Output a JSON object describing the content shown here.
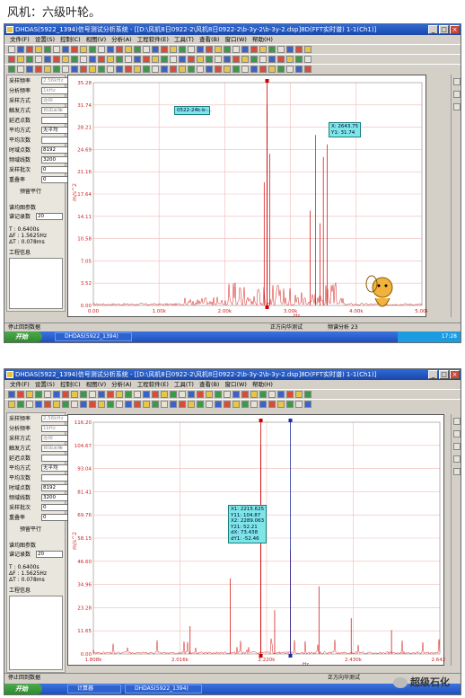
{
  "caption": "风机：六级叶轮。",
  "win1": {
    "title": "DHDAS(5922_1394)信号测试分析系统 - [[D:\\风机8日0922-2\\风机8日0922-2\\b-3y-2\\b-3y-2.dsp]8D(FFT实时谱) 1-1(Ch1)]",
    "menu": [
      "文件(F)",
      "设置(S)",
      "控制(C)",
      "视图(V)",
      "分析(A)",
      "工程软件(E)",
      "工具(T)",
      "查看(B)",
      "窗口(W)",
      "帮助(H)"
    ],
    "params": [
      {
        "label": "采样频率",
        "value": "2.56kHz",
        "active": false
      },
      {
        "label": "分析频率",
        "value": "1kHz",
        "active": false
      },
      {
        "label": "采样方式",
        "value": "连续",
        "active": false
      },
      {
        "label": "触发方式",
        "value": "自由采集",
        "active": false
      },
      {
        "label": "延迟点数",
        "value": "",
        "active": false
      },
      {
        "label": "平均方式",
        "value": "无平均",
        "active": true
      },
      {
        "label": "平均次数",
        "value": "",
        "active": false
      },
      {
        "label": "时域点数",
        "value": "8192",
        "active": true
      },
      {
        "label": "频域线数",
        "value": "3200",
        "active": true
      },
      {
        "label": "采样批次",
        "value": "0",
        "active": true
      },
      {
        "label": "重叠率",
        "value": "0",
        "active": true
      }
    ],
    "checkbox_label": "预留平行",
    "records_label": "谱均图参数",
    "records_count_label": "谱记录数",
    "records_count_value": "20",
    "stats": [
      "T : 0.6400s",
      "ΔF : 1.5625Hz",
      "ΔT : 0.078ms"
    ],
    "info_label": "工程信息",
    "status_text": "停止回到数据",
    "status_right": "正方向华测试",
    "status_freq": "频谱分析 23",
    "cursor_popup": "0522-24k-b-...",
    "cursor_readout": "X: 2643.75\nY1: 31.74",
    "ylabel": "m/s^2",
    "xlabel": "Hz",
    "task_label": "DHDAS(5922_1394)",
    "tray_time": "17:28",
    "start_label": "开始"
  },
  "win2": {
    "title": "DHDAS(5922_1394)信号测试分析系统 - [[D:\\风机8日0922-2\\风机8日0922-2\\b-3y-2\\b-3y-2.dsp]8D(FFT实时谱) 1-1(Ch1)]",
    "menu": [
      "文件(F)",
      "设置(S)",
      "控制(C)",
      "视图(V)",
      "分析(A)",
      "工程软件(E)",
      "工具(T)",
      "查看(B)",
      "窗口(W)",
      "帮助(H)"
    ],
    "params": [
      {
        "label": "采样频率",
        "value": "2.56kHz",
        "active": false
      },
      {
        "label": "分析频率",
        "value": "1kHz",
        "active": false
      },
      {
        "label": "采样方式",
        "value": "连续",
        "active": false
      },
      {
        "label": "触发方式",
        "value": "自由采集",
        "active": false
      },
      {
        "label": "延迟点数",
        "value": "",
        "active": false
      },
      {
        "label": "平均方式",
        "value": "无平均",
        "active": true
      },
      {
        "label": "平均次数",
        "value": "",
        "active": false
      },
      {
        "label": "时域点数",
        "value": "8192",
        "active": true
      },
      {
        "label": "频域线数",
        "value": "3200",
        "active": true
      },
      {
        "label": "采样批次",
        "value": "0",
        "active": true
      },
      {
        "label": "重叠率",
        "value": "0",
        "active": true
      }
    ],
    "checkbox_label": "预留平行",
    "records_label": "谱均图参数",
    "records_count_label": "谱记录数",
    "records_count_value": "20",
    "stats": [
      "T : 0.6400s",
      "ΔF : 1.5625Hz",
      "ΔT : 0.078ms"
    ],
    "info_label": "工程信息",
    "status_text": "停止回到数据",
    "status_right": "正方向华测试",
    "status_freq": "频谱分析 23",
    "cursor_readout": "X1: 2215.625\nY11: 104.87\nX2: 2289.063\nY21: 52.21\ndX: 73.438\ndY1: -52.46",
    "ylabel": "m/s^2",
    "xlabel": "Hz",
    "task_label": "DHDAS(5922_1394)",
    "task_label2": "计算器",
    "start_label": "开始",
    "logo_text": "超级石化"
  },
  "chart_data": [
    {
      "type": "line",
      "title": "",
      "xlabel": "Hz",
      "ylabel": "m/s^2",
      "xlim": [
        0,
        5000
      ],
      "ylim": [
        0,
        35.28
      ],
      "x_ticks": [
        "0.00",
        "1.00k",
        "2.00k",
        "3.00k",
        "4.00k",
        "5.00k"
      ],
      "y_ticks": [
        "0.00",
        "3.52",
        "7.05",
        "10.58",
        "14.11",
        "17.64",
        "21.16",
        "24.69",
        "28.21",
        "31.74",
        "35.28"
      ],
      "grid": true,
      "peaks": [
        {
          "x": 2643.75,
          "y": 31.74
        },
        {
          "x": 2600,
          "y": 19.5
        },
        {
          "x": 2685,
          "y": 24.0
        },
        {
          "x": 3380,
          "y": 27.0
        },
        {
          "x": 3500,
          "y": 23.5
        },
        {
          "x": 3560,
          "y": 25.5
        },
        {
          "x": 3300,
          "y": 15.0
        },
        {
          "x": 3450,
          "y": 13.0
        }
      ],
      "cursor_x": 2643.75
    },
    {
      "type": "line",
      "title": "",
      "xlabel": "Hz",
      "ylabel": "m/s^2",
      "xlim": [
        1800,
        2660
      ],
      "ylim": [
        0,
        116.53
      ],
      "x_ticks": [
        "1.808k",
        "2.016k",
        "2.220k",
        "2.430k",
        "2.642k"
      ],
      "y_ticks": [
        "0.00",
        "11.65",
        "23.28",
        "34.96",
        "46.60",
        "58.15",
        "69.76",
        "81.41",
        "93.04",
        "104.67",
        "116.20"
      ],
      "grid": true,
      "peaks": [
        {
          "x": 2215.625,
          "y": 104.87
        },
        {
          "x": 2289.063,
          "y": 52.21
        },
        {
          "x": 2140,
          "y": 38.0
        },
        {
          "x": 2360,
          "y": 34.0
        },
        {
          "x": 2250,
          "y": 22.0
        },
        {
          "x": 2040,
          "y": 14.0
        },
        {
          "x": 2440,
          "y": 18.0
        },
        {
          "x": 2540,
          "y": 12.0
        }
      ],
      "cursor_x1": 2215.625,
      "cursor_x2": 2289.063
    }
  ]
}
